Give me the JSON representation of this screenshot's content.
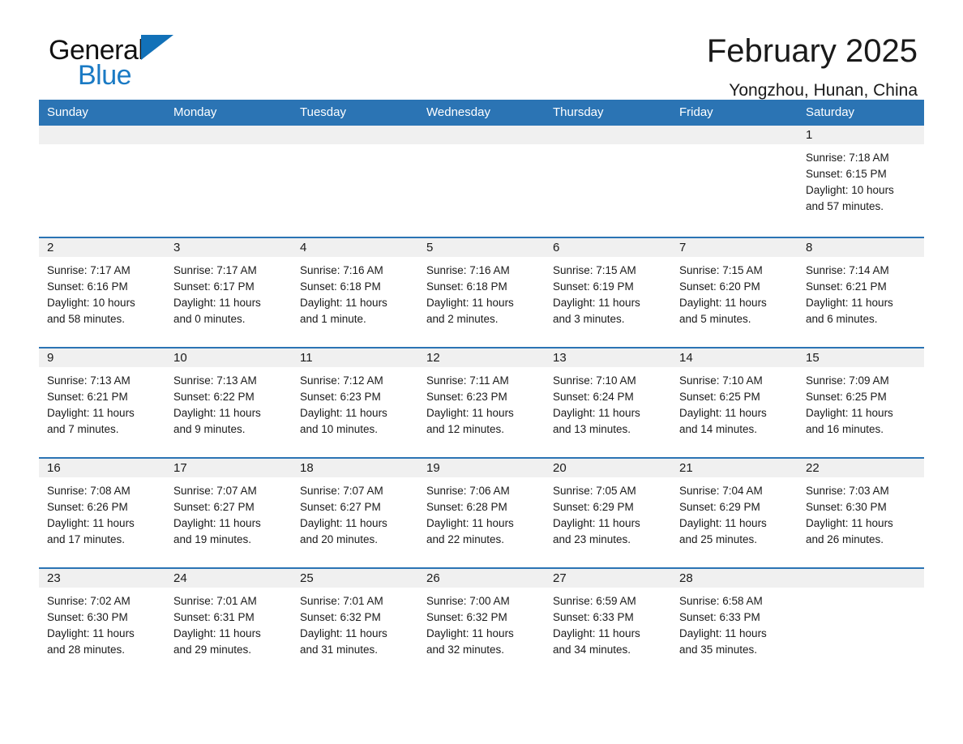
{
  "brand": {
    "name_part1": "General",
    "name_part2": "Blue",
    "triangle_color": "#1271b8",
    "blue_color": "#1a7ac4"
  },
  "header": {
    "title": "February 2025",
    "subtitle": "Yongzhou, Hunan, China"
  },
  "theme": {
    "header_blue": "#2b74b4",
    "daynum_band": "#f0f0f0",
    "text": "#1a1a1a"
  },
  "calendar": {
    "weekday_headers": [
      "Sunday",
      "Monday",
      "Tuesday",
      "Wednesday",
      "Thursday",
      "Friday",
      "Saturday"
    ],
    "weeks": [
      [
        {
          "day": "",
          "sunrise": "",
          "sunset": "",
          "daylight_line1": "",
          "daylight_line2": ""
        },
        {
          "day": "",
          "sunrise": "",
          "sunset": "",
          "daylight_line1": "",
          "daylight_line2": ""
        },
        {
          "day": "",
          "sunrise": "",
          "sunset": "",
          "daylight_line1": "",
          "daylight_line2": ""
        },
        {
          "day": "",
          "sunrise": "",
          "sunset": "",
          "daylight_line1": "",
          "daylight_line2": ""
        },
        {
          "day": "",
          "sunrise": "",
          "sunset": "",
          "daylight_line1": "",
          "daylight_line2": ""
        },
        {
          "day": "",
          "sunrise": "",
          "sunset": "",
          "daylight_line1": "",
          "daylight_line2": ""
        },
        {
          "day": "1",
          "sunrise": "Sunrise: 7:18 AM",
          "sunset": "Sunset: 6:15 PM",
          "daylight_line1": "Daylight: 10 hours",
          "daylight_line2": "and 57 minutes."
        }
      ],
      [
        {
          "day": "2",
          "sunrise": "Sunrise: 7:17 AM",
          "sunset": "Sunset: 6:16 PM",
          "daylight_line1": "Daylight: 10 hours",
          "daylight_line2": "and 58 minutes."
        },
        {
          "day": "3",
          "sunrise": "Sunrise: 7:17 AM",
          "sunset": "Sunset: 6:17 PM",
          "daylight_line1": "Daylight: 11 hours",
          "daylight_line2": "and 0 minutes."
        },
        {
          "day": "4",
          "sunrise": "Sunrise: 7:16 AM",
          "sunset": "Sunset: 6:18 PM",
          "daylight_line1": "Daylight: 11 hours",
          "daylight_line2": "and 1 minute."
        },
        {
          "day": "5",
          "sunrise": "Sunrise: 7:16 AM",
          "sunset": "Sunset: 6:18 PM",
          "daylight_line1": "Daylight: 11 hours",
          "daylight_line2": "and 2 minutes."
        },
        {
          "day": "6",
          "sunrise": "Sunrise: 7:15 AM",
          "sunset": "Sunset: 6:19 PM",
          "daylight_line1": "Daylight: 11 hours",
          "daylight_line2": "and 3 minutes."
        },
        {
          "day": "7",
          "sunrise": "Sunrise: 7:15 AM",
          "sunset": "Sunset: 6:20 PM",
          "daylight_line1": "Daylight: 11 hours",
          "daylight_line2": "and 5 minutes."
        },
        {
          "day": "8",
          "sunrise": "Sunrise: 7:14 AM",
          "sunset": "Sunset: 6:21 PM",
          "daylight_line1": "Daylight: 11 hours",
          "daylight_line2": "and 6 minutes."
        }
      ],
      [
        {
          "day": "9",
          "sunrise": "Sunrise: 7:13 AM",
          "sunset": "Sunset: 6:21 PM",
          "daylight_line1": "Daylight: 11 hours",
          "daylight_line2": "and 7 minutes."
        },
        {
          "day": "10",
          "sunrise": "Sunrise: 7:13 AM",
          "sunset": "Sunset: 6:22 PM",
          "daylight_line1": "Daylight: 11 hours",
          "daylight_line2": "and 9 minutes."
        },
        {
          "day": "11",
          "sunrise": "Sunrise: 7:12 AM",
          "sunset": "Sunset: 6:23 PM",
          "daylight_line1": "Daylight: 11 hours",
          "daylight_line2": "and 10 minutes."
        },
        {
          "day": "12",
          "sunrise": "Sunrise: 7:11 AM",
          "sunset": "Sunset: 6:23 PM",
          "daylight_line1": "Daylight: 11 hours",
          "daylight_line2": "and 12 minutes."
        },
        {
          "day": "13",
          "sunrise": "Sunrise: 7:10 AM",
          "sunset": "Sunset: 6:24 PM",
          "daylight_line1": "Daylight: 11 hours",
          "daylight_line2": "and 13 minutes."
        },
        {
          "day": "14",
          "sunrise": "Sunrise: 7:10 AM",
          "sunset": "Sunset: 6:25 PM",
          "daylight_line1": "Daylight: 11 hours",
          "daylight_line2": "and 14 minutes."
        },
        {
          "day": "15",
          "sunrise": "Sunrise: 7:09 AM",
          "sunset": "Sunset: 6:25 PM",
          "daylight_line1": "Daylight: 11 hours",
          "daylight_line2": "and 16 minutes."
        }
      ],
      [
        {
          "day": "16",
          "sunrise": "Sunrise: 7:08 AM",
          "sunset": "Sunset: 6:26 PM",
          "daylight_line1": "Daylight: 11 hours",
          "daylight_line2": "and 17 minutes."
        },
        {
          "day": "17",
          "sunrise": "Sunrise: 7:07 AM",
          "sunset": "Sunset: 6:27 PM",
          "daylight_line1": "Daylight: 11 hours",
          "daylight_line2": "and 19 minutes."
        },
        {
          "day": "18",
          "sunrise": "Sunrise: 7:07 AM",
          "sunset": "Sunset: 6:27 PM",
          "daylight_line1": "Daylight: 11 hours",
          "daylight_line2": "and 20 minutes."
        },
        {
          "day": "19",
          "sunrise": "Sunrise: 7:06 AM",
          "sunset": "Sunset: 6:28 PM",
          "daylight_line1": "Daylight: 11 hours",
          "daylight_line2": "and 22 minutes."
        },
        {
          "day": "20",
          "sunrise": "Sunrise: 7:05 AM",
          "sunset": "Sunset: 6:29 PM",
          "daylight_line1": "Daylight: 11 hours",
          "daylight_line2": "and 23 minutes."
        },
        {
          "day": "21",
          "sunrise": "Sunrise: 7:04 AM",
          "sunset": "Sunset: 6:29 PM",
          "daylight_line1": "Daylight: 11 hours",
          "daylight_line2": "and 25 minutes."
        },
        {
          "day": "22",
          "sunrise": "Sunrise: 7:03 AM",
          "sunset": "Sunset: 6:30 PM",
          "daylight_line1": "Daylight: 11 hours",
          "daylight_line2": "and 26 minutes."
        }
      ],
      [
        {
          "day": "23",
          "sunrise": "Sunrise: 7:02 AM",
          "sunset": "Sunset: 6:30 PM",
          "daylight_line1": "Daylight: 11 hours",
          "daylight_line2": "and 28 minutes."
        },
        {
          "day": "24",
          "sunrise": "Sunrise: 7:01 AM",
          "sunset": "Sunset: 6:31 PM",
          "daylight_line1": "Daylight: 11 hours",
          "daylight_line2": "and 29 minutes."
        },
        {
          "day": "25",
          "sunrise": "Sunrise: 7:01 AM",
          "sunset": "Sunset: 6:32 PM",
          "daylight_line1": "Daylight: 11 hours",
          "daylight_line2": "and 31 minutes."
        },
        {
          "day": "26",
          "sunrise": "Sunrise: 7:00 AM",
          "sunset": "Sunset: 6:32 PM",
          "daylight_line1": "Daylight: 11 hours",
          "daylight_line2": "and 32 minutes."
        },
        {
          "day": "27",
          "sunrise": "Sunrise: 6:59 AM",
          "sunset": "Sunset: 6:33 PM",
          "daylight_line1": "Daylight: 11 hours",
          "daylight_line2": "and 34 minutes."
        },
        {
          "day": "28",
          "sunrise": "Sunrise: 6:58 AM",
          "sunset": "Sunset: 6:33 PM",
          "daylight_line1": "Daylight: 11 hours",
          "daylight_line2": "and 35 minutes."
        },
        {
          "day": "",
          "sunrise": "",
          "sunset": "",
          "daylight_line1": "",
          "daylight_line2": ""
        }
      ]
    ]
  }
}
